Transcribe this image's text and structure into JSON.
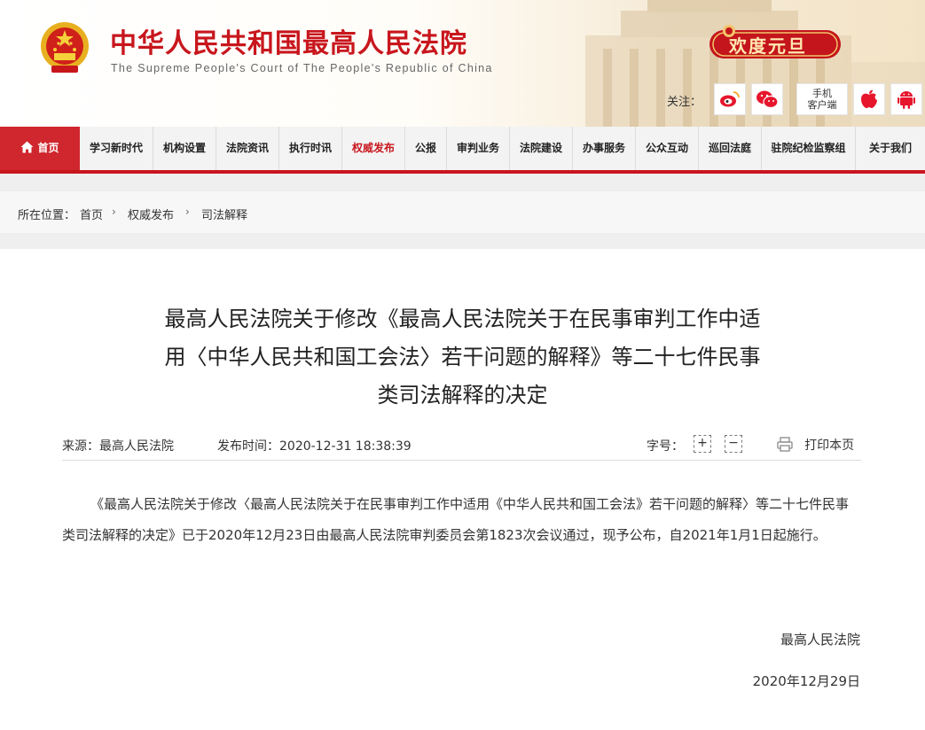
{
  "site": {
    "title_cn": "中华人民共和国最高人民法院",
    "title_en": "The Supreme People's Court of The People's Republic of China",
    "banner": "欢度元旦",
    "follow_label": "关注：",
    "mobile_line1": "手机",
    "mobile_line2": "客户端",
    "brand_red": "#c8161d"
  },
  "icons": [
    "weibo-icon",
    "wechat-icon",
    "apple-icon",
    "android-icon",
    "home-icon",
    "print-icon"
  ],
  "nav": {
    "items": [
      "首页",
      "学习新时代",
      "机构设置",
      "法院资讯",
      "执行时讯",
      "权威发布",
      "公报",
      "审判业务",
      "法院建设",
      "办事服务",
      "公众互动",
      "巡回法庭",
      "驻院纪检监察组",
      "关于我们"
    ],
    "active": "权威发布"
  },
  "breadcrumb": {
    "label": "所在位置：",
    "items": [
      "首页",
      "权威发布",
      "司法解释"
    ],
    "sep": "›"
  },
  "article": {
    "title_lines": [
      "最高人民法院关于修改《最高人民法院关于在民事审判工作中适",
      "用〈中华人民共和国工会法〉若干问题的解释》等二十七件民事",
      "类司法解释的决定"
    ],
    "source": "来源：最高人民法院",
    "publish_time": "发布时间：2020-12-31 18:38:39",
    "font_size_label": "字号：",
    "font_plus": "+",
    "font_minus": "−",
    "print_label": "打印本页",
    "body": "《最高人民法院关于修改〈最高人民法院关于在民事审判工作中适用《中华人民共和国工会法》若干问题的解释〉等二十七件民事类司法解释的决定》已于2020年12月23日由最高人民法院审判委员会第1823次会议通过，现予公布，自2021年1月1日起施行。",
    "signature": "最高人民法院",
    "date": "2020年12月29日"
  }
}
